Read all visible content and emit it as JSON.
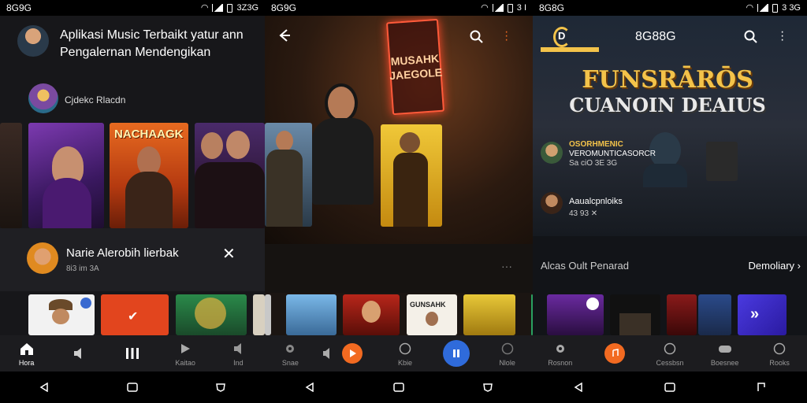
{
  "panels": [
    {
      "status": {
        "time": "8G9G",
        "battery": "3Z3G"
      },
      "header": {
        "title": "Aplikasi Music Terbaikt yatur ann Pengalernan Mendengikan"
      },
      "user": {
        "name": "Cjdekc Rlacdn"
      },
      "mini_player": {
        "title": "Narie Alerobih lierbak",
        "meta": "8i3 im 3A"
      },
      "bottom_nav": [
        {
          "label": "Hora",
          "icon": "home-icon",
          "active": true
        },
        {
          "label": "",
          "icon": "speaker-icon"
        },
        {
          "label": "",
          "icon": "pause-bars-icon"
        },
        {
          "label": "Kaitao",
          "icon": "play-icon"
        },
        {
          "label": "Ind",
          "icon": "speaker-icon"
        }
      ]
    },
    {
      "status": {
        "time": "8G9G",
        "battery": "3 I"
      },
      "hero_sign": "MUSAHK JAEGOLE",
      "bottom_nav": [
        {
          "label": "Snae",
          "icon": "gear-icon"
        },
        {
          "label": "",
          "icon": "speaker-icon"
        },
        {
          "label": "Kbie",
          "icon": "disc-icon"
        },
        {
          "label": "Nlole",
          "icon": "circle-icon"
        }
      ],
      "thumb_text": "GUNSAHK"
    },
    {
      "status": {
        "time": "8G8G",
        "battery": "3 3G"
      },
      "header": {
        "title": "8G88G",
        "logo_letter": "D"
      },
      "hero_title_line1": "FUNSRĀRŌS",
      "hero_title_line2": "CUANOIN DEAIUS",
      "cards": [
        {
          "title": "OSORHMENIC",
          "line2": "VEROMUNTICASORCR",
          "meta": "Sa ciO 3E 3G"
        },
        {
          "title": "Aaualcpnloiks",
          "meta": "43 93 ✕"
        }
      ],
      "section": {
        "title": "Alcas Oult Penarad",
        "action": "Demoliary"
      },
      "bottom_nav": [
        {
          "label": "Rosnon",
          "icon": "gear-icon"
        },
        {
          "label": "",
          "icon": "music-icon"
        },
        {
          "label": "Cessbsn",
          "icon": "circle-icon"
        },
        {
          "label": "Boesnee",
          "icon": "controller-icon"
        },
        {
          "label": "Rooks",
          "icon": "circle-icon"
        }
      ]
    }
  ],
  "colors": {
    "accent_orange": "#f26a21",
    "accent_blue": "#2f6bdb",
    "title_gold": "#f3c34a"
  }
}
